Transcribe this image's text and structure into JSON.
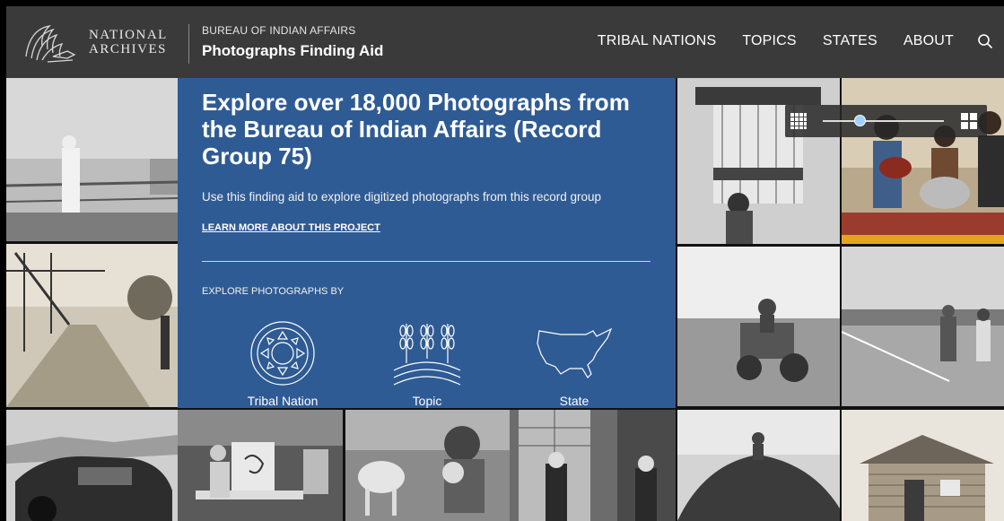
{
  "header": {
    "logo_line1": "NATIONAL",
    "logo_line2": "ARCHIVES",
    "kicker": "BUREAU OF INDIAN AFFAIRS",
    "site_name": "Photographs Finding Aid",
    "nav": [
      "TRIBAL NATIONS",
      "TOPICS",
      "STATES",
      "ABOUT"
    ],
    "search_icon": "search-icon"
  },
  "hero": {
    "title": "Explore over 18,000 Photographs from the Bureau of Indian Affairs (Record Group 75)",
    "subtitle": "Use this finding aid to explore digitized photographs from this record group",
    "link": "LEARN MORE ABOUT THIS PROJECT",
    "explore_label": "EXPLORE PHOTOGRAPHS BY",
    "categories": [
      {
        "label": "Tribal Nation",
        "icon": "tribal-nation-icon"
      },
      {
        "label": "Topic",
        "icon": "topic-icon"
      },
      {
        "label": "State",
        "icon": "us-map-icon"
      }
    ]
  },
  "zoom": {
    "level": 0.3,
    "small_icon": "grid-small-icon",
    "large_icon": "grid-large-icon"
  },
  "colors": {
    "header_bg": "#3a3a3a",
    "hero_bg": "#2f5b94"
  }
}
